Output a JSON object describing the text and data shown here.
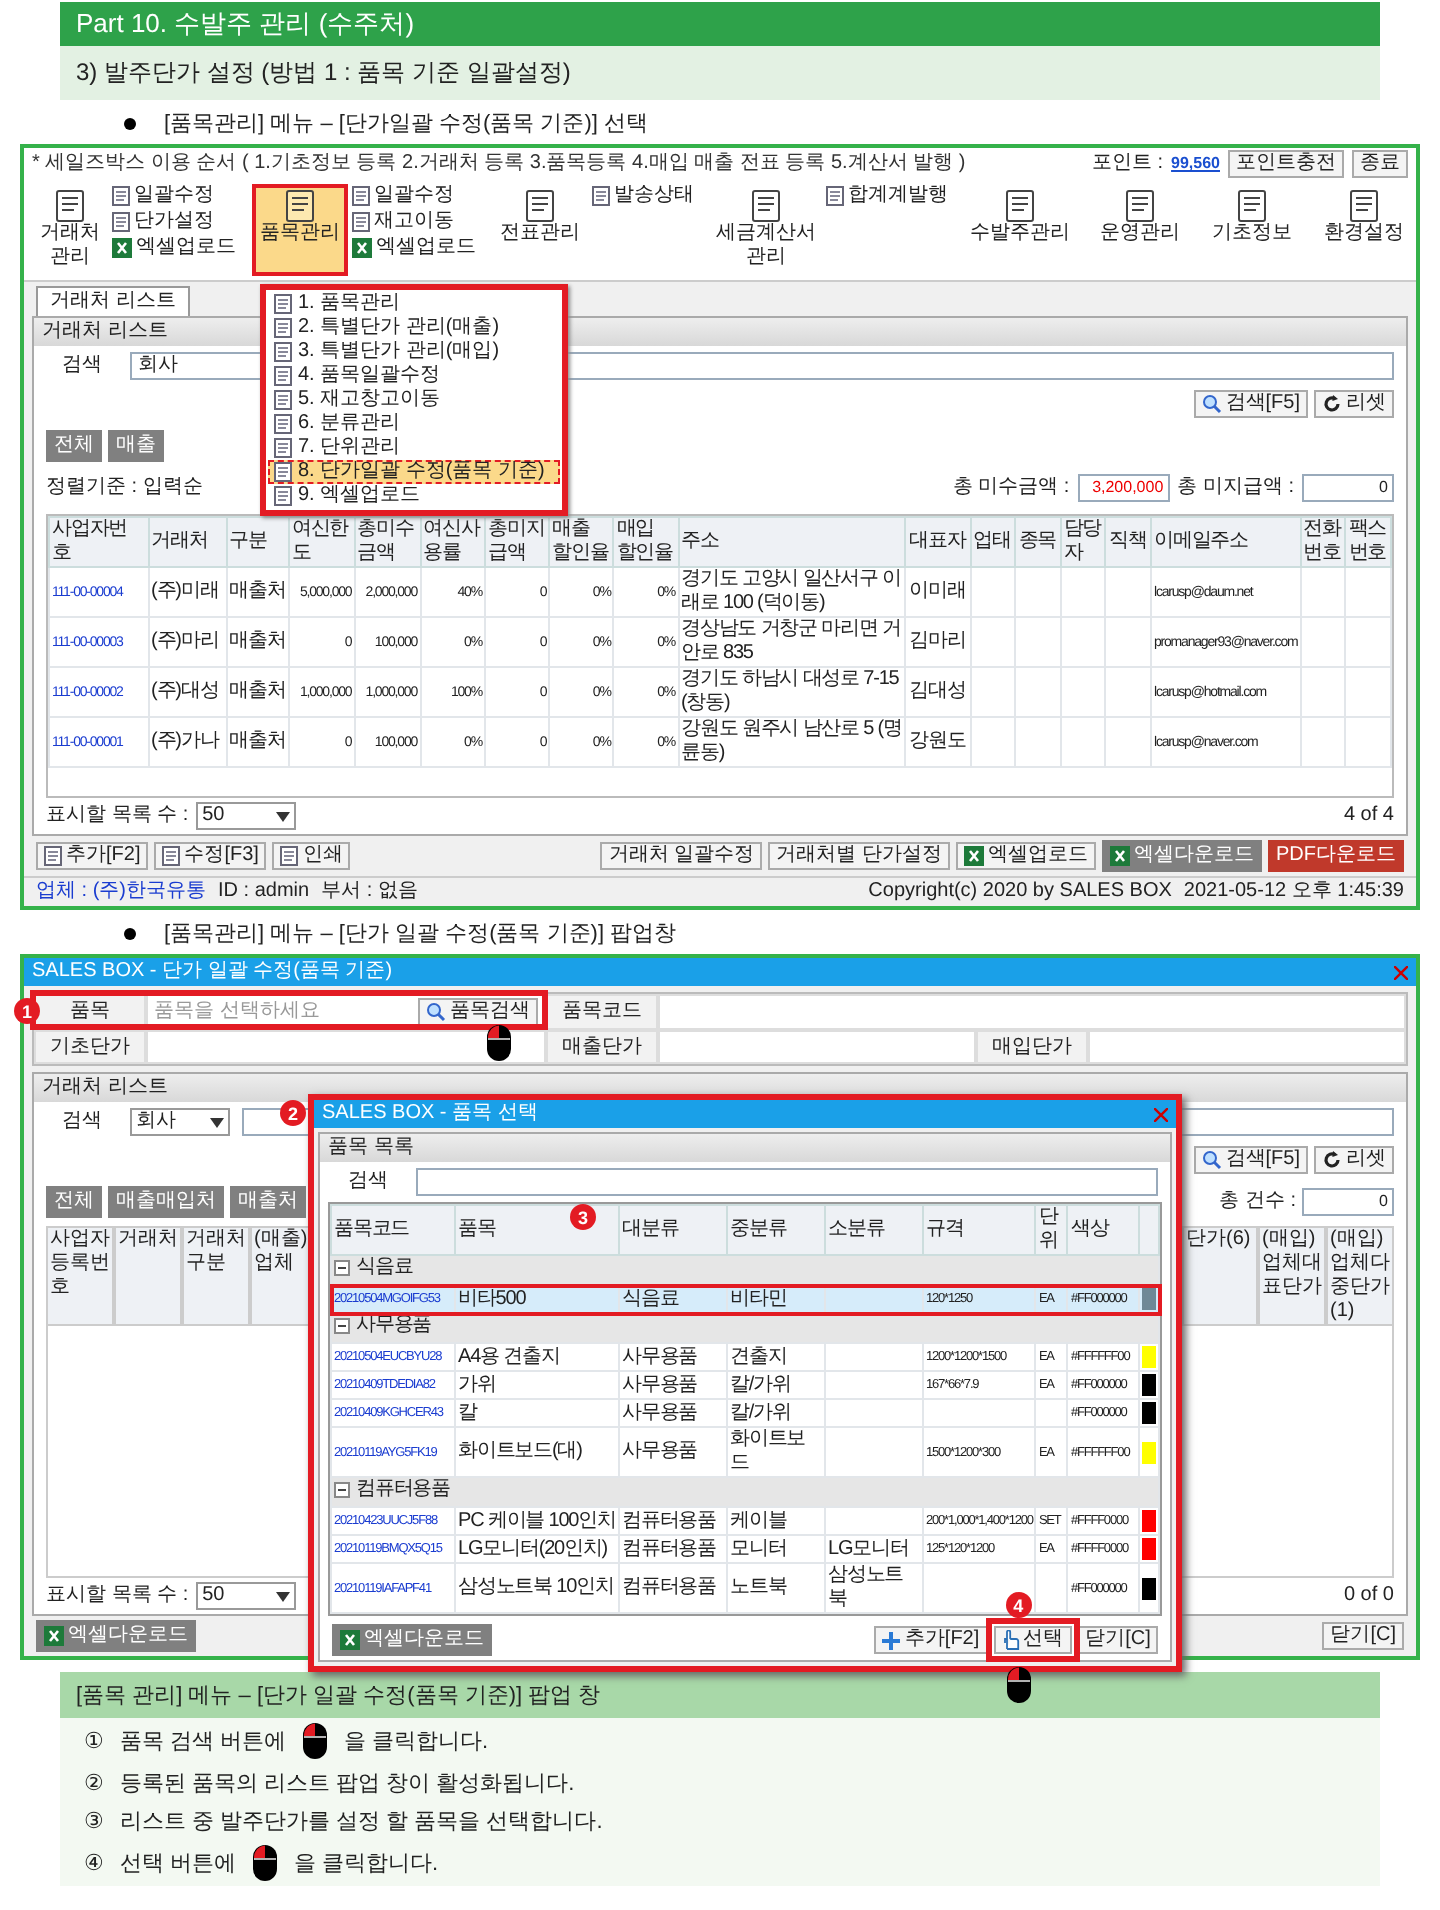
{
  "page_header": {
    "title": "Part 10. 수발주 관리 (수주처)"
  },
  "section_title": "3) 발주단가 설정 (방법 1 : 품목 기준 일괄설정)",
  "bullet_1": "[품목관리] 메뉴 – [단가일괄 수정(품목 기준)] 선택",
  "app_window": {
    "notice": "* 세일즈박스 이용 순서 ( 1.기초정보 등록  2.거래처 등록  3.품목등록  4.매입 매출 전표 등록  5.계산서 발행 )",
    "points_label": "포인트 :",
    "points": "99,560",
    "top_buttons": [
      "포인트충전",
      "종료"
    ],
    "ribbon": [
      {
        "label": "거래처 관리",
        "selected": false,
        "small": [
          {
            "label": "일괄수정",
            "kind": "doc"
          },
          {
            "label": "단가설정",
            "kind": "doc"
          },
          {
            "label": "엑셀업로드",
            "kind": "excel"
          }
        ]
      },
      {
        "label": "품목관리",
        "selected": true,
        "small": [
          {
            "label": "일괄수정",
            "kind": "doc"
          },
          {
            "label": "재고이동",
            "kind": "doc"
          },
          {
            "label": "엑셀업로드",
            "kind": "excel"
          }
        ]
      },
      {
        "label": "전표관리",
        "selected": false,
        "small": [
          {
            "label": "발송상태",
            "kind": "doc"
          }
        ]
      },
      {
        "label": "세금계산서 관리",
        "selected": false,
        "small": [
          {
            "label": "합계계발행",
            "kind": "doc"
          }
        ]
      },
      {
        "label": "수발주관리",
        "selected": false
      },
      {
        "label": "운영관리",
        "selected": false
      },
      {
        "label": "기초정보",
        "selected": false
      },
      {
        "label": "환경설정",
        "selected": false
      }
    ],
    "menu": [
      {
        "label": "1. 품목관리",
        "selected": false
      },
      {
        "label": "2. 특별단가 관리(매출)",
        "selected": false
      },
      {
        "label": "3. 특별단가 관리(매입)",
        "selected": false
      },
      {
        "label": "4. 품목일괄수정",
        "selected": false
      },
      {
        "label": "5. 재고창고이동",
        "selected": false
      },
      {
        "label": "6. 분류관리",
        "selected": false
      },
      {
        "label": "7. 단위관리",
        "selected": false
      },
      {
        "label": "8. 단가일괄 수정(품목 기준)",
        "selected": true
      },
      {
        "label": "9. 엑셀업로드",
        "selected": false
      }
    ],
    "doc_tab": "거래처 리스트",
    "panel_title": "거래처 리스트",
    "search_label": "검색",
    "search_value": "회사",
    "search_button": "검색[F5]",
    "reset_button": "리셋",
    "filter_tabs": [
      "전체",
      "매출"
    ],
    "sort": "정렬기준 : 입력순",
    "receivable_label": "총 미수금액 :",
    "receivable": "3,200,000",
    "payable_label": "총 미지급액 :",
    "payable": "0",
    "table": {
      "columns": [
        "사업자번호",
        "거래처",
        "구분",
        "여신한도",
        "총미수금액",
        "여신사용률",
        "총미지급액",
        "매출 할인율",
        "매입 할인율",
        "주소",
        "대표자",
        "업태",
        "종목",
        "담당자",
        "직책",
        "이메일주소",
        "전화번호",
        "팩스번호"
      ],
      "rows": [
        [
          "111-00-00004",
          "(주)미래",
          "매출처",
          "5,000,000",
          "2,000,000",
          "40%",
          "0",
          "0%",
          "0%",
          "경기도 고양시 일산서구 이래로 100 (덕이동)",
          "이미래",
          "",
          "",
          "",
          "",
          "lcarusp@daum.net",
          "",
          ""
        ],
        [
          "111-00-00003",
          "(주)마리",
          "매출처",
          "0",
          "100,000",
          "0%",
          "0",
          "0%",
          "0%",
          "경상남도 거창군 마리면 거안로 835",
          "김마리",
          "",
          "",
          "",
          "",
          "promanager93@naver.com",
          "",
          ""
        ],
        [
          "111-00-00002",
          "(주)대성",
          "매출처",
          "1,000,000",
          "1,000,000",
          "100%",
          "0",
          "0%",
          "0%",
          "경기도 하남시 대성로 7-15 (창동)",
          "김대성",
          "",
          "",
          "",
          "",
          "lcarusp@hotmail.com",
          "",
          ""
        ],
        [
          "111-00-00001",
          "(주)가나",
          "매출처",
          "0",
          "100,000",
          "0%",
          "0",
          "0%",
          "0%",
          "강원도 원주시 남산로 5 (명륜동)",
          "강원도",
          "",
          "",
          "",
          "",
          "lcarusp@naver.com",
          "",
          ""
        ]
      ]
    },
    "page_size_label": "표시할 목록 수 :",
    "page_size": "50",
    "pager": "4 of 4",
    "left_buttons": [
      "추가[F2]",
      "수정[F3]",
      "인쇄"
    ],
    "right_buttons": [
      "거래처 일괄수정",
      "거래처별 단가설정",
      "엑셀업로드",
      "엑셀다운로드",
      "PDF다운로드"
    ],
    "status": [
      "업체 : (주)한국유통",
      "ID : admin",
      "부서 : 없음"
    ],
    "copyright": "Copyright(c) 2020 by SALES BOX",
    "datetime": "2021-05-12 오후 1:45:39"
  },
  "bullet_2": "[품목관리] 메뉴 – [단가 일괄 수정(품목 기준)] 팝업창",
  "popup_window": {
    "title": "SALES BOX - 단가 일괄 수정(품목 기준)",
    "form": {
      "callout": "1",
      "item_label": "품목",
      "item_placeholder": "품목을 선택하세요",
      "item_search_button": "품목검색",
      "code_label": "품목코드",
      "base_price_label": "기초단가",
      "sale_price_label": "매출단가",
      "purchase_price_label": "매입단가"
    },
    "panel_title": "거래처 리스트",
    "search_label": "검색",
    "search_value": "회사",
    "search_button": "검색[F5]",
    "reset_button": "리셋",
    "filter_tabs": [
      "전체",
      "매출매입처",
      "매출처"
    ],
    "count_label": "총 건수 :",
    "count": "0",
    "columns_left": [
      "사업자등록번호",
      "거래처",
      "거래처 구분",
      "(매출)업체"
    ],
    "columns_right": [
      "단가(6)",
      "(매입)업체대표단가",
      "(매입)업체다중단가(1)"
    ],
    "page_size_label": "표시할 목록 수 :",
    "page_size": "50",
    "pager": "0 of 0",
    "excel_button": "엑셀다운로드",
    "close_button": "닫기[C]",
    "dialog": {
      "callout": "2",
      "title": "SALES BOX - 품목 선택",
      "panel_title": "품목 목록",
      "search_label": "검색",
      "row_callout": "3",
      "columns": [
        "품목코드",
        "품목",
        "대분류",
        "중분류",
        "소분류",
        "규격",
        "단위",
        "색상"
      ],
      "groups": [
        {
          "name": "식음료",
          "expanded": true,
          "rows": [
            {
              "cells": [
                "20210504MGOIFG53",
                "비타500",
                "식음료",
                "비타민",
                "",
                "120*1250",
                "EA",
                "#FF000000"
              ],
              "color": "#6e8896",
              "selected": true
            }
          ]
        },
        {
          "name": "사무용품",
          "expanded": true,
          "rows": [
            {
              "cells": [
                "20210504EUCBYU28",
                "A4용 견출지",
                "사무용품",
                "견출지",
                "",
                "1200*1200*1500",
                "EA",
                "#FFFFFF00"
              ],
              "color": "#ffff00",
              "selected": false
            },
            {
              "cells": [
                "20210409TDEDIA82",
                "가위",
                "사무용품",
                "칼/가위",
                "",
                "167*66*7.9",
                "EA",
                "#FF000000"
              ],
              "color": "#000000",
              "selected": false
            },
            {
              "cells": [
                "20210409KGHCER43",
                "칼",
                "사무용품",
                "칼/가위",
                "",
                "",
                "",
                "#FF000000"
              ],
              "color": "#000000",
              "selected": false
            },
            {
              "cells": [
                "20210119AYG5FK19",
                "화이트보드(대)",
                "사무용품",
                "화이트보드",
                "",
                "1500*1200*300",
                "EA",
                "#FFFFFF00"
              ],
              "color": "#ffff00",
              "selected": false
            }
          ]
        },
        {
          "name": "컴퓨터용품",
          "expanded": true,
          "rows": [
            {
              "cells": [
                "20210423UUCJ5F88",
                "PC 케이블 100인치",
                "컴퓨터용품",
                "케이블",
                "",
                "200*1,000*1,400*1200",
                "SET",
                "#FFFF0000"
              ],
              "color": "#ff0000",
              "selected": false
            },
            {
              "cells": [
                "20210119BMQX5Q15",
                "LG모니터(20인치)",
                "컴퓨터용품",
                "모니터",
                "LG모니터",
                "125*120*1200",
                "EA",
                "#FFFF0000"
              ],
              "color": "#ff0000",
              "selected": false
            },
            {
              "cells": [
                "20210119IAFAPF41",
                "삼성노트북 10인치",
                "컴퓨터용품",
                "노트북",
                "삼성노트북",
                "",
                "",
                "#FF000000"
              ],
              "color": "#000000",
              "selected": false
            }
          ]
        }
      ],
      "excel_button": "엑셀다운로드",
      "add_button": "추가[F2]",
      "select_button": "선택",
      "select_callout": "4",
      "close_button": "닫기[C]"
    }
  },
  "instructions": {
    "title": "[품목 관리] 메뉴 – [단가 일괄 수정(품목 기준)] 팝업 창",
    "steps": [
      {
        "number": "①",
        "text": "품목 검색 버튼에",
        "text_after": "을 클릭합니다.",
        "mouse": true
      },
      {
        "number": "②",
        "text": "등록된 품목의 리스트 팝업 창이 활성화됩니다.",
        "mouse": false
      },
      {
        "number": "③",
        "text": "리스트 중 발주단가를 설정 할 품목을 선택합니다.",
        "mouse": false
      },
      {
        "number": "④",
        "text": "선택 버튼에",
        "text_after": "을  클릭합니다.",
        "mouse": true
      }
    ]
  }
}
